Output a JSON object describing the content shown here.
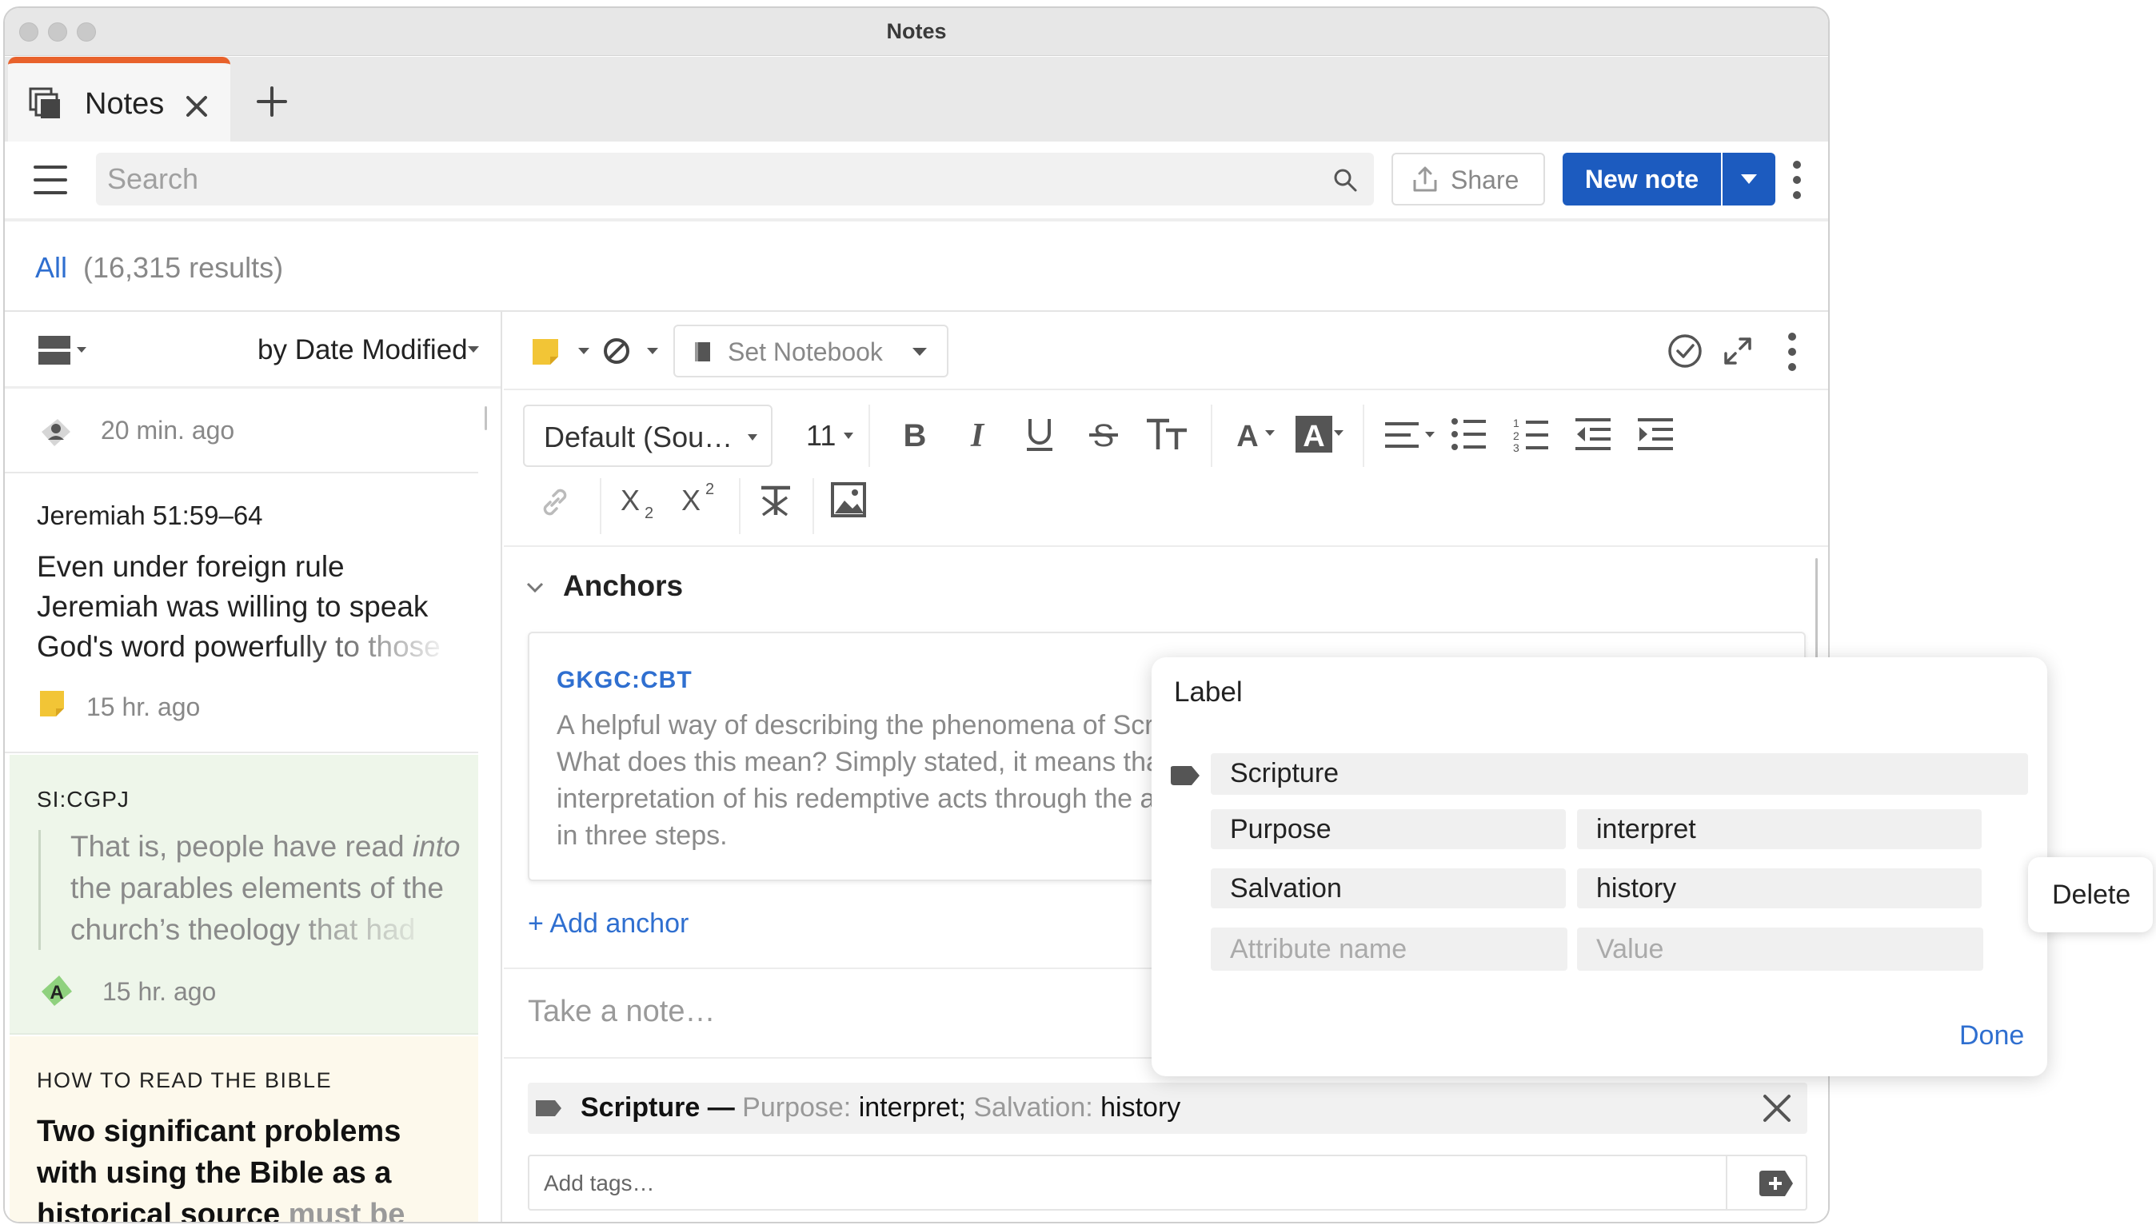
{
  "window": {
    "title": "Notes"
  },
  "tabs": [
    {
      "label": "Notes",
      "icon": "notes-stack-icon",
      "active": true
    }
  ],
  "toolbar": {
    "search_placeholder": "Search",
    "share_label": "Share",
    "new_note_label": "New note"
  },
  "results": {
    "filter_label": "All",
    "count_text": "(16,315 results)"
  },
  "list": {
    "sort_label": "by Date Modified",
    "items": [
      {
        "time": "20 min. ago",
        "icon": "user-note-icon"
      },
      {
        "reference": "Jeremiah 51:59–64",
        "body_lines": [
          "Even under foreign rule",
          "Jeremiah was willing to speak",
          "God's word powerfully to those"
        ],
        "time": "15 hr. ago",
        "icon": "sticky-note-icon"
      },
      {
        "reference": "SI:CGPJ",
        "quote_lines": [
          "That is, people have read ",
          "into",
          "the parables elements of the",
          "church’s theology that had"
        ],
        "time": "15 hr. ago",
        "icon": "highlight-a-icon",
        "icon_letter": "A"
      },
      {
        "source": "HOW TO READ THE BIBLE",
        "title_lines": [
          "Two significant problems",
          "with using the Bible as a",
          "historical source "
        ],
        "title_faded": "must be"
      }
    ]
  },
  "editor": {
    "notebook_label": "Set Notebook",
    "font_label": "Default (Sou…",
    "font_size": "11",
    "anchors_heading": "Anchors",
    "anchor": {
      "ref": "GKGC:CBT",
      "lines": [
        "A helpful way of describing the phenomena of Scri",
        "What does this mean? Simply stated, it means tha",
        "interpretation of his redemptive acts through the a",
        "in three steps."
      ]
    },
    "add_anchor_label": "+ Add anchor",
    "note_placeholder": "Take a note…",
    "label_bar": {
      "name": "Scripture",
      "dash": "—",
      "attr1_name": "Purpose:",
      "attr1_value": "interpret;",
      "attr2_name": "Salvation:",
      "attr2_value": "history"
    },
    "tags_placeholder": "Add tags…"
  },
  "label_popup": {
    "title": "Label",
    "label_value": "Scripture",
    "attributes": [
      {
        "name": "Purpose",
        "value": "interpret"
      },
      {
        "name": "Salvation",
        "value": "history"
      }
    ],
    "attr_name_placeholder": "Attribute name",
    "attr_value_placeholder": "Value",
    "done_label": "Done"
  },
  "context_menu": {
    "delete_label": "Delete"
  },
  "colors": {
    "accent_blue": "#1c5bbf",
    "link_blue": "#2f6fd0",
    "tab_accent_orange": "#e8622c",
    "sticky_yellow": "#f2c536",
    "highlight_green": "#8fd17e",
    "selected_item_green": "#eef6ea",
    "book_item_cream": "#fdf9ec"
  }
}
